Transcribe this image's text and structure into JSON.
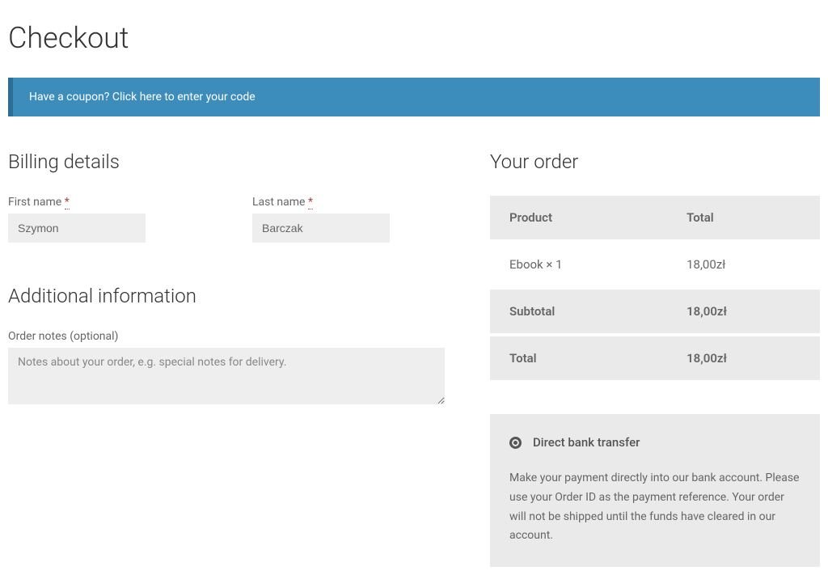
{
  "page": {
    "title": "Checkout"
  },
  "coupon": {
    "prompt": "Have a coupon? ",
    "link": "Click here to enter your code"
  },
  "billing": {
    "heading": "Billing details",
    "first_name_label": "First name ",
    "last_name_label": "Last name ",
    "required_mark": "*",
    "first_name_value": "Szymon",
    "last_name_value": "Barczak"
  },
  "additional": {
    "heading": "Additional information",
    "notes_label": "Order notes (optional)",
    "notes_placeholder": "Notes about your order, e.g. special notes for delivery."
  },
  "order": {
    "heading": "Your order",
    "col_product": "Product",
    "col_total": "Total",
    "items": [
      {
        "name": "Ebook  × 1",
        "total": "18,00zł"
      }
    ],
    "subtotal_label": "Subtotal",
    "subtotal_value": "18,00zł",
    "total_label": "Total",
    "total_value": "18,00zł"
  },
  "payment": {
    "method_label": "Direct bank transfer",
    "description": "Make your payment directly into our bank account. Please use your Order ID as the payment reference. Your order will not be shipped until the funds have cleared in our account."
  }
}
